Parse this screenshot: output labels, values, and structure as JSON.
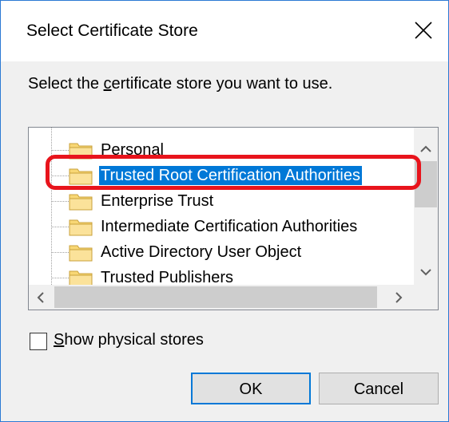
{
  "dialog": {
    "title": "Select Certificate Store",
    "close_icon": "close-icon"
  },
  "instruction": {
    "before": "Select the ",
    "mnemonic": "c",
    "after": "ertificate store you want to use."
  },
  "stores": [
    {
      "label": "Personal",
      "selected": false
    },
    {
      "label": "Trusted Root Certification Authorities",
      "selected": true
    },
    {
      "label": "Enterprise Trust",
      "selected": false
    },
    {
      "label": "Intermediate Certification Authorities",
      "selected": false
    },
    {
      "label": "Active Directory User Object",
      "selected": false
    },
    {
      "label": "Trusted Publishers",
      "selected": false
    }
  ],
  "show_physical": {
    "mnemonic": "S",
    "rest": "how physical stores",
    "checked": false
  },
  "buttons": {
    "ok": "OK",
    "cancel": "Cancel"
  },
  "colors": {
    "selection": "#0078d7",
    "highlight": "#e8141c",
    "window_border": "#2b79d4",
    "folder": "#f8d775"
  }
}
